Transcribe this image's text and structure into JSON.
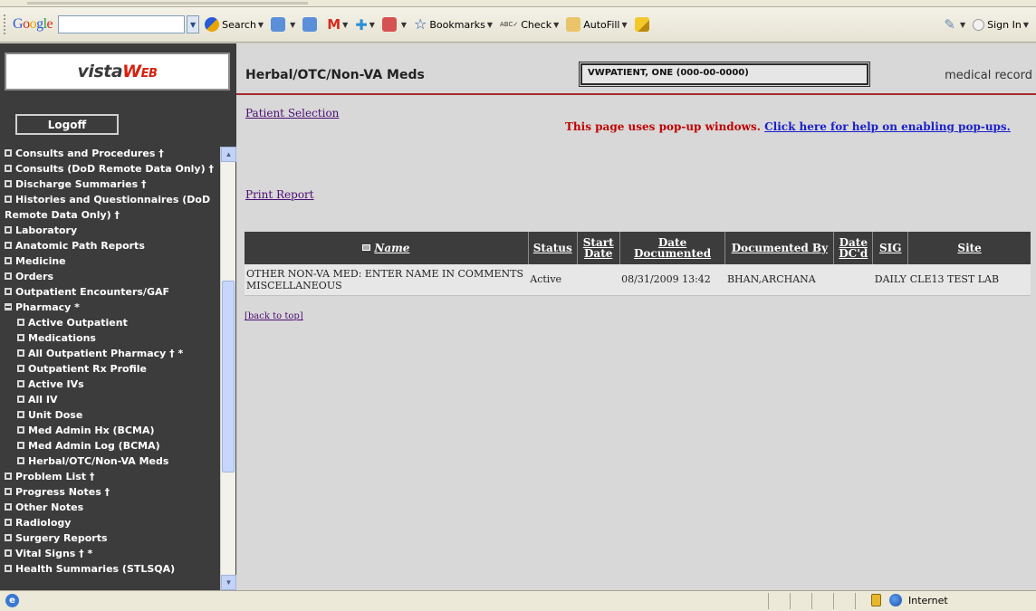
{
  "browser": {
    "toolbar": {
      "logo": "Google",
      "search_value": "",
      "search": "Search",
      "bookmarks": "Bookmarks",
      "check": "Check",
      "autofill": "AutoFill",
      "signin": "Sign In"
    },
    "status": {
      "zone": "Internet"
    }
  },
  "sidebar": {
    "logo": {
      "part1": "vista",
      "part2": "W",
      "part3": "EB"
    },
    "logoff_label": "Logoff",
    "items": [
      {
        "label": "Consults and Procedures †",
        "sub": false,
        "expanded": false
      },
      {
        "label": "Consults (DoD Remote Data Only) †",
        "sub": false,
        "expanded": false
      },
      {
        "label": "Discharge Summaries †",
        "sub": false,
        "expanded": false
      },
      {
        "label": "Histories and Questionnaires (DoD Remote Data Only) †",
        "sub": false,
        "expanded": false
      },
      {
        "label": "Laboratory",
        "sub": false,
        "expanded": false
      },
      {
        "label": "Anatomic Path Reports",
        "sub": false,
        "expanded": false
      },
      {
        "label": "Medicine",
        "sub": false,
        "expanded": false
      },
      {
        "label": "Orders",
        "sub": false,
        "expanded": false
      },
      {
        "label": "Outpatient Encounters/GAF",
        "sub": false,
        "expanded": false
      },
      {
        "label": "Pharmacy *",
        "sub": false,
        "expanded": true
      },
      {
        "label": "Active Outpatient",
        "sub": true,
        "expanded": false
      },
      {
        "label": "Medications",
        "sub": true,
        "expanded": false
      },
      {
        "label": "All Outpatient Pharmacy † *",
        "sub": true,
        "expanded": false
      },
      {
        "label": "Outpatient Rx Profile",
        "sub": true,
        "expanded": false
      },
      {
        "label": "Active IVs",
        "sub": true,
        "expanded": false
      },
      {
        "label": "All IV",
        "sub": true,
        "expanded": false
      },
      {
        "label": "Unit Dose",
        "sub": true,
        "expanded": false
      },
      {
        "label": "Med Admin Hx (BCMA)",
        "sub": true,
        "expanded": false
      },
      {
        "label": "Med Admin Log (BCMA)",
        "sub": true,
        "expanded": false
      },
      {
        "label": "Herbal/OTC/Non-VA Meds",
        "sub": true,
        "expanded": false
      },
      {
        "label": "Problem List †",
        "sub": false,
        "expanded": false
      },
      {
        "label": "Progress Notes †",
        "sub": false,
        "expanded": false
      },
      {
        "label": "Other Notes",
        "sub": false,
        "expanded": false
      },
      {
        "label": "Radiology",
        "sub": false,
        "expanded": false
      },
      {
        "label": "Surgery Reports",
        "sub": false,
        "expanded": false
      },
      {
        "label": "Vital Signs † *",
        "sub": false,
        "expanded": false
      },
      {
        "label": "Health Summaries (STLSQA)",
        "sub": false,
        "expanded": false
      }
    ]
  },
  "main": {
    "title": "Herbal/OTC/Non-VA Meds",
    "patient": "VWPATIENT, ONE (000-00-0000)",
    "record_label": "medical record",
    "patient_selection": "Patient Selection",
    "popup_note": "This page uses pop-up windows.",
    "popup_link": "Click here for help on enabling pop-ups.",
    "print_report": "Print Report",
    "back_to_top": "[back to top]",
    "table": {
      "headers": {
        "name": "Name",
        "status": "Status",
        "start": "Start Date",
        "documented": "Date Documented",
        "doc_by": "Documented By",
        "dc": "Date DC'd",
        "sig": "SIG",
        "site": "Site"
      },
      "rows": [
        {
          "name": "OTHER NON-VA MED: ENTER NAME IN COMMENTS MISCELLANEOUS",
          "status": "Active",
          "start": "",
          "documented": "08/31/2009 13:42",
          "doc_by": "BHAN,ARCHANA",
          "dc": "",
          "sig": "DAILY",
          "site": "CLE13 TEST LAB"
        }
      ]
    }
  },
  "colors": {
    "sidebar_bg": "#3c3c3c",
    "main_bg": "#d9d8d8",
    "header_rule": "#a52a2a",
    "popup_note": "#c00000",
    "link": "#4a0d73",
    "popup_link": "#1a20c9"
  }
}
